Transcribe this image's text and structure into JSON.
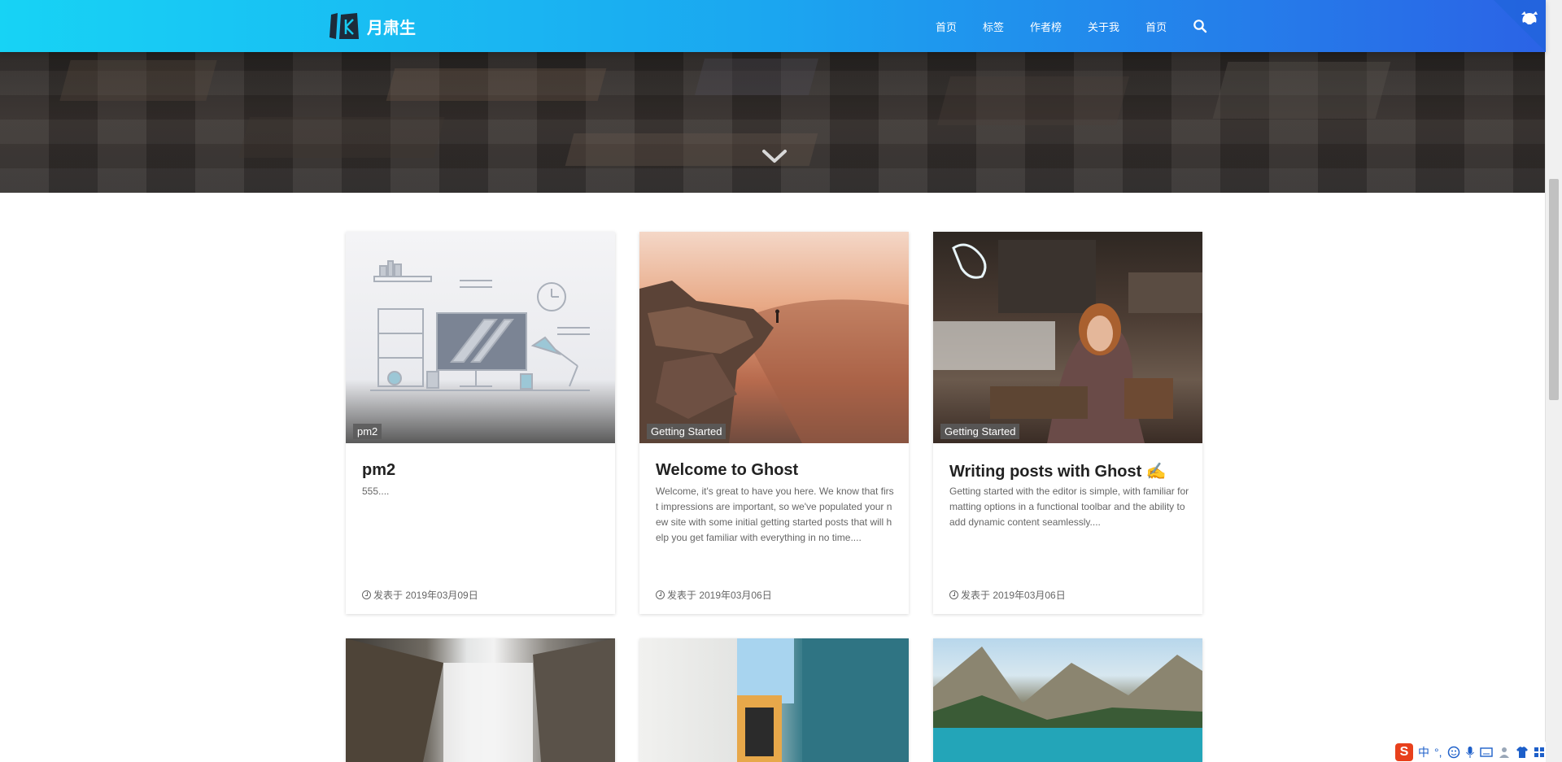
{
  "header": {
    "logo_text": "月肃生",
    "nav": [
      "首页",
      "标签",
      "作者榜",
      "关于我",
      "首页"
    ]
  },
  "colors": {
    "header_start": "#17d3f5",
    "header_end": "#2b63e6",
    "tag_bg": "#5a5a5a"
  },
  "posts": [
    {
      "tag": "pm2",
      "title": "pm2",
      "excerpt": "555....",
      "date_label": "发表于 2019年03月09日",
      "image": "illustrated-desk-workspace"
    },
    {
      "tag": "Getting Started",
      "title": "Welcome to Ghost",
      "excerpt": "Welcome, it's great to have you here. We know that first impressions are important, so we've populated your new site with some initial getting started posts that will help you get familiar with everything in no time....",
      "date_label": "发表于 2019年03月06日",
      "image": "hiker-on-cliff-at-sunset"
    },
    {
      "tag": "Getting Started",
      "title": "Writing posts with Ghost ✍️",
      "excerpt": "Getting started with the editor is simple, with familiar formatting options in a functional toolbar and the ability to add dynamic content seamlessly....",
      "date_label": "发表于 2019年03月06日",
      "image": "woman-in-cafe-with-laptop"
    }
  ],
  "tray": {
    "ime_logo": "S",
    "ime_lang": "中",
    "ime_punct": "°,"
  }
}
